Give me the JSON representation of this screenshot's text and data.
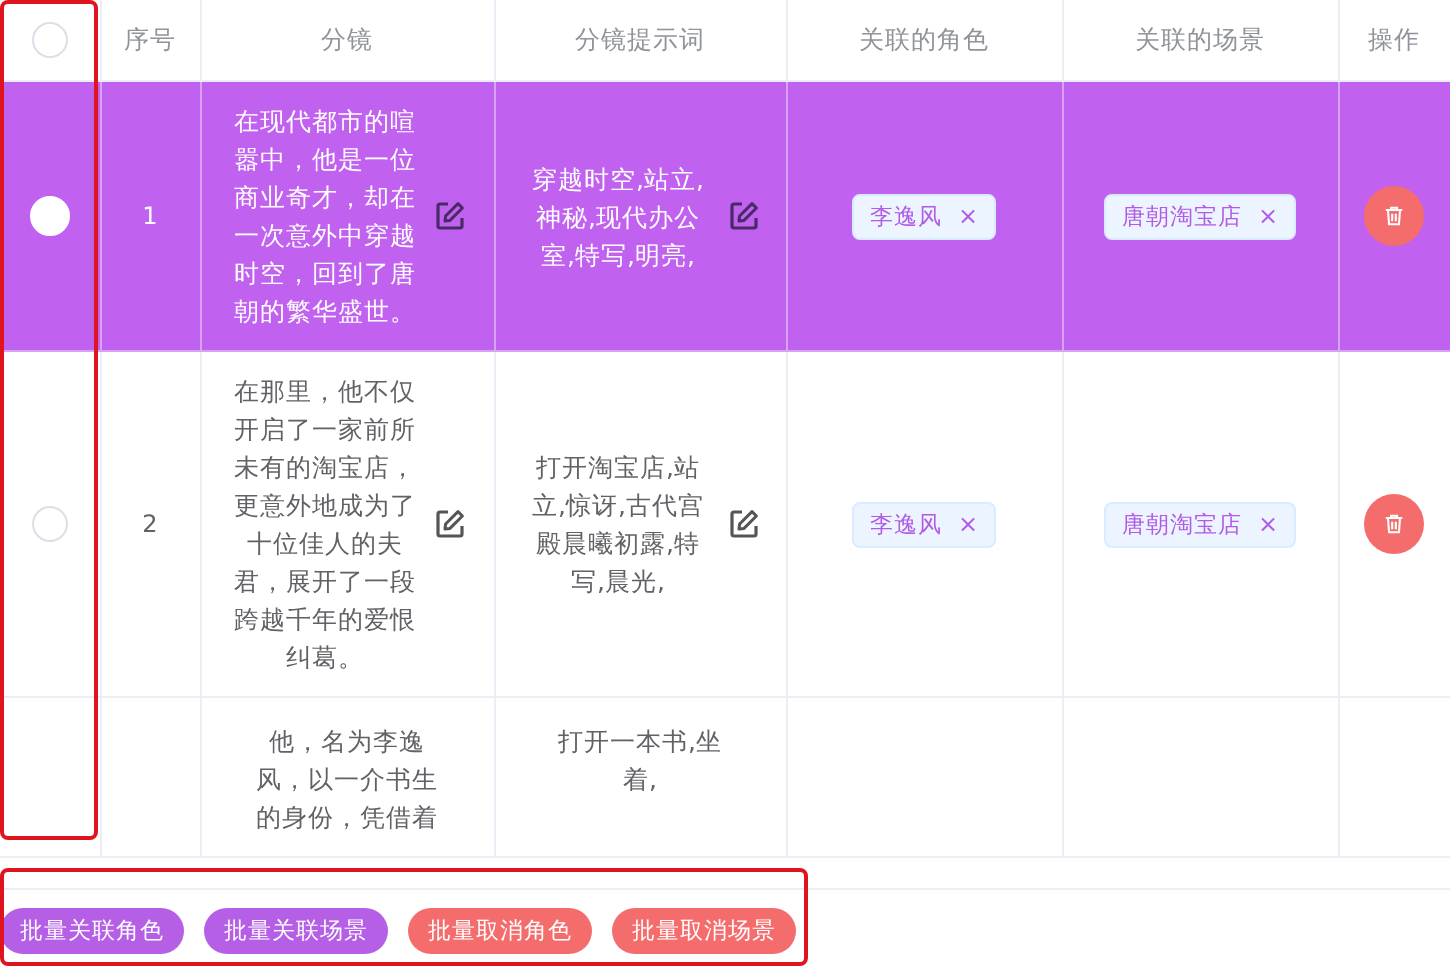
{
  "table": {
    "select_all": {
      "checked": false
    },
    "columns": [
      "序号",
      "分镜",
      "分镜提示词",
      "关联的角色",
      "关联的场景",
      "操作"
    ],
    "rows": [
      {
        "selected": true,
        "index": "1",
        "scene": "在现代都市的喧嚣中，他是一位商业奇才，却在一次意外中穿越时空，回到了唐朝的繁华盛世。",
        "prompt": "穿越时空,站立,神秘,现代办公室,特写,明亮,",
        "characters": [
          {
            "label": "李逸风",
            "close": "×"
          }
        ],
        "locations": [
          {
            "label": "唐朝淘宝店",
            "close": "×"
          }
        ]
      },
      {
        "selected": false,
        "index": "2",
        "scene": "在那里，他不仅开启了一家前所未有的淘宝店，更意外地成为了十位佳人的夫君，展开了一段跨越千年的爱恨纠葛。",
        "prompt": "打开淘宝店,站立,惊讶,古代宫殿晨曦初露,特写,晨光,",
        "characters": [
          {
            "label": "李逸风",
            "close": "×"
          }
        ],
        "locations": [
          {
            "label": "唐朝淘宝店",
            "close": "×"
          }
        ]
      },
      {
        "scene": "他，名为李逸风，以一介书生的身份，凭借着",
        "prompt": "打开一本书,坐着,"
      }
    ]
  },
  "batch_buttons": [
    {
      "label": "批量关联角色",
      "kind": "primary"
    },
    {
      "label": "批量关联场景",
      "kind": "primary"
    },
    {
      "label": "批量取消角色",
      "kind": "danger"
    },
    {
      "label": "批量取消场景",
      "kind": "danger"
    }
  ]
}
